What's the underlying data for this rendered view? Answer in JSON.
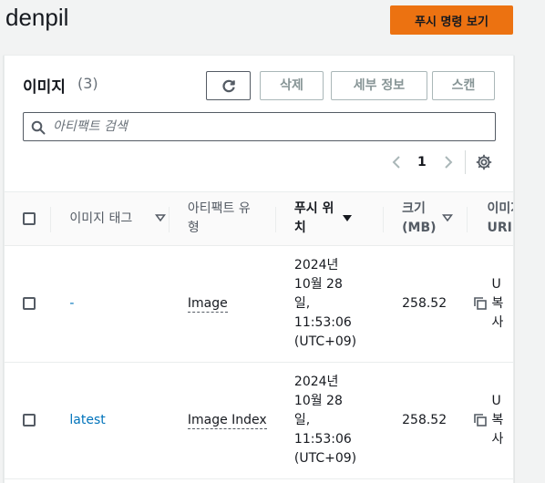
{
  "header": {
    "title": "denpil",
    "push_button": "푸시 명령 보기"
  },
  "panel": {
    "title": "이미지",
    "count": "(3)",
    "buttons": {
      "delete": "삭제",
      "details": "세부 정보",
      "scan": "스캔"
    },
    "search_placeholder": "아티팩트 검색",
    "page_number": "1"
  },
  "table": {
    "columns": {
      "tag": "이미지 태그",
      "artifact_type": "아티팩트 유형",
      "pushed_at": "푸시 위치",
      "size": "크기 (MB)",
      "uri": "이미지 URI"
    },
    "rows": [
      {
        "tag": "-",
        "artifact_type": "Image",
        "pushed_at": "2024년 10월 28일, 11:53:06 (UTC+09)",
        "size": "258.52",
        "uri_partial": [
          "U",
          "복",
          "사"
        ]
      },
      {
        "tag": "latest",
        "artifact_type": "Image Index",
        "pushed_at": "2024년 10월 28일, 11:53:06 (UTC+09)",
        "size": "258.52",
        "uri_partial": [
          "U",
          "복",
          "사"
        ]
      }
    ]
  },
  "colors": {
    "accent": "#ec7211",
    "link": "#0073bb"
  },
  "icons": [
    "refresh-icon",
    "search-icon",
    "chevron-left-icon",
    "chevron-right-icon",
    "settings-icon",
    "sort-caret-icon",
    "copy-icon"
  ]
}
